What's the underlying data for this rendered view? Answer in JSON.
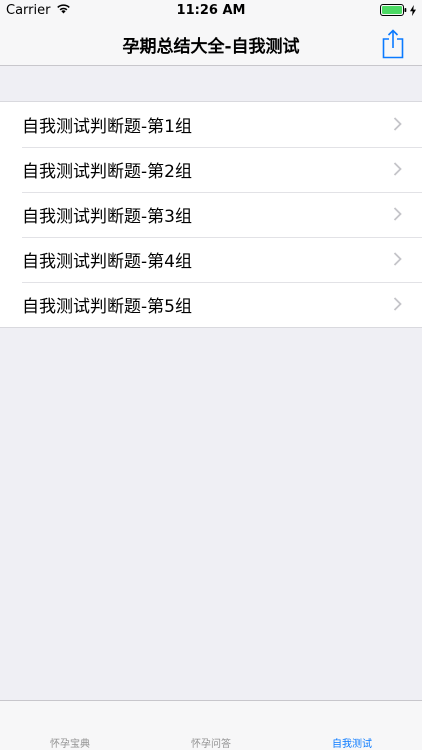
{
  "status_bar": {
    "carrier": "Carrier",
    "time": "11:26 AM"
  },
  "nav": {
    "title": "孕期总结大全-自我测试",
    "share_icon": "share-icon"
  },
  "list": {
    "items": [
      {
        "label": "自我测试判断题-第1组"
      },
      {
        "label": "自我测试判断题-第2组"
      },
      {
        "label": "自我测试判断题-第3组"
      },
      {
        "label": "自我测试判断题-第4组"
      },
      {
        "label": "自我测试判断题-第5组"
      }
    ]
  },
  "tab_bar": {
    "tabs": [
      {
        "label": "怀孕宝典",
        "active": false
      },
      {
        "label": "怀孕问答",
        "active": false
      },
      {
        "label": "自我测试",
        "active": true
      }
    ]
  },
  "colors": {
    "accent": "#0a7aff",
    "background": "#efeff4",
    "bar": "#f7f7f8",
    "inactive_tab": "#929292",
    "battery": "#4cd964"
  }
}
